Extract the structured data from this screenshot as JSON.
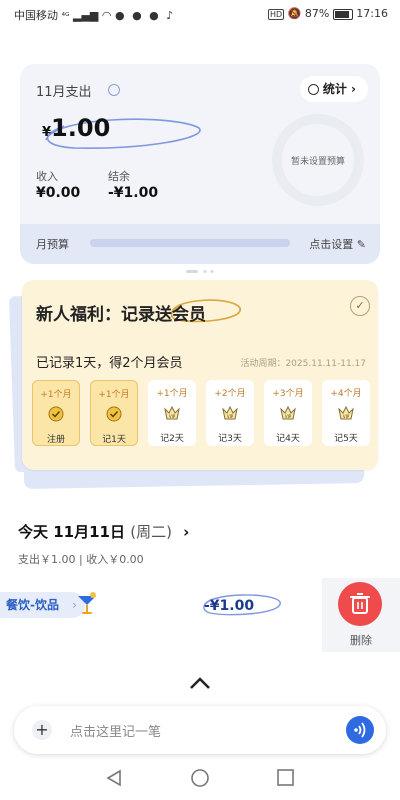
{
  "status_bar": {
    "carrier": "中国移动",
    "signal": "⁴ᴳ",
    "battery": "87%",
    "time": "17:16"
  },
  "expense_card": {
    "month_label": "11月支出",
    "stats_button": "统计",
    "currency": "¥",
    "amount": "1.00",
    "income_label": "收入",
    "income_value": "¥0.00",
    "balance_label": "结余",
    "balance_value": "-¥1.00",
    "budget_ring_text": "暂未设置预算",
    "budget_label": "月预算",
    "budget_set_label": "点击设置"
  },
  "welfare": {
    "title": "新人福利：记录送会员",
    "subtitle": "已记录1天，得2个月会员",
    "period": "活动周期：2025.11.11-11.17",
    "tiles": [
      {
        "top": "+1个月",
        "bottom": "注册",
        "done": true
      },
      {
        "top": "+1个月",
        "bottom": "记1天",
        "done": true
      },
      {
        "top": "+1个月",
        "bottom": "记2天",
        "done": false
      },
      {
        "top": "+2个月",
        "bottom": "记3天",
        "done": false
      },
      {
        "top": "+3个月",
        "bottom": "记4天",
        "done": false
      },
      {
        "top": "+4个月",
        "bottom": "记5天",
        "done": false
      }
    ]
  },
  "today": {
    "title": "今天 11月11日",
    "weekday": "(周二)",
    "summary": "支出￥1.00 | 收入￥0.00"
  },
  "record": {
    "category": "餐饮-饮品",
    "amount": "-¥1.00",
    "delete_label": "删除"
  },
  "input": {
    "placeholder": "点击这里记一笔"
  },
  "colors": {
    "accent": "#2f6ae0",
    "delete": "#ef4b4b",
    "welfare_bg": "#fdf3d9"
  }
}
